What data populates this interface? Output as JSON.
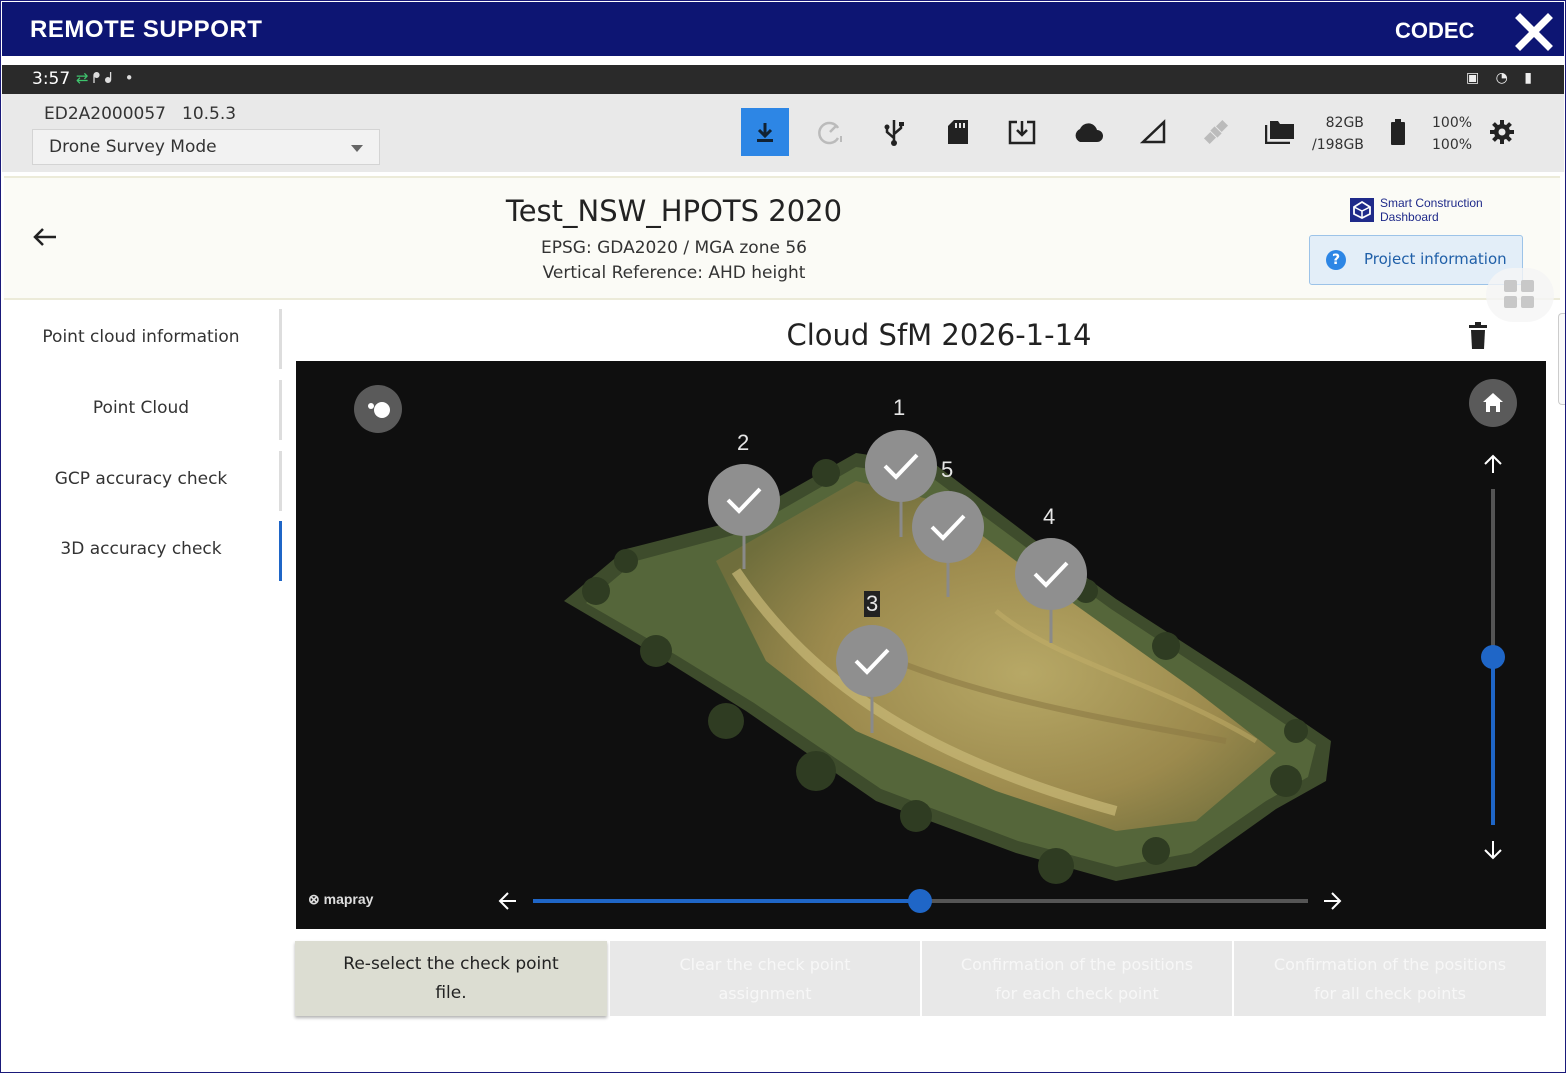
{
  "remote_support": {
    "title": "REMOTE SUPPORT",
    "codec": "CODEC",
    "close_icon": "close-icon"
  },
  "status_bar": {
    "time": "3:57"
  },
  "device": {
    "id": "ED2A2000057",
    "version": "10.5.3",
    "mode": "Drone Survey Mode",
    "storage_used": "82GB",
    "storage_total": "/198GB",
    "battery_1": "100%",
    "battery_2": "100%",
    "toolbar_icons": [
      "download-icon",
      "gauge-icon",
      "usb-icon",
      "sd-card-icon",
      "import-icon",
      "cloud-icon",
      "slope-icon",
      "satellite-icon",
      "folders-icon",
      "battery-icon",
      "gear-icon"
    ]
  },
  "project": {
    "title": "Test_NSW_HPOTS 2020",
    "epsg": "EPSG: GDA2020 / MGA zone 56",
    "vertical_reference": "Vertical Reference: AHD height",
    "logo_text_1": "Smart Construction",
    "logo_text_2": "Dashboard",
    "info_button": "Project information"
  },
  "sidebar": {
    "items": [
      {
        "label": "Point cloud information",
        "active": false
      },
      {
        "label": "Point Cloud",
        "active": false
      },
      {
        "label": "GCP accuracy check",
        "active": false
      },
      {
        "label": "3D accuracy check",
        "active": true
      }
    ]
  },
  "main": {
    "cloud_title": "Cloud SfM 2026-1-14",
    "viewer": {
      "markers": [
        "1",
        "2",
        "3",
        "4",
        "5"
      ],
      "watermark": "mapray",
      "horizontal_slider": 0.5,
      "vertical_slider": 0.52
    },
    "steps": [
      {
        "label": "Re-select the check point file.",
        "enabled": true
      },
      {
        "label": "Clear the check point assignment",
        "enabled": false
      },
      {
        "label": "Confirmation of the positions for each check point",
        "enabled": false
      },
      {
        "label": "Confirmation of the positions for all check points",
        "enabled": false
      }
    ]
  },
  "colors": {
    "remote_bar": "#0d1573",
    "accent": "#2d86e5",
    "active_tab": "#1f66c7"
  }
}
